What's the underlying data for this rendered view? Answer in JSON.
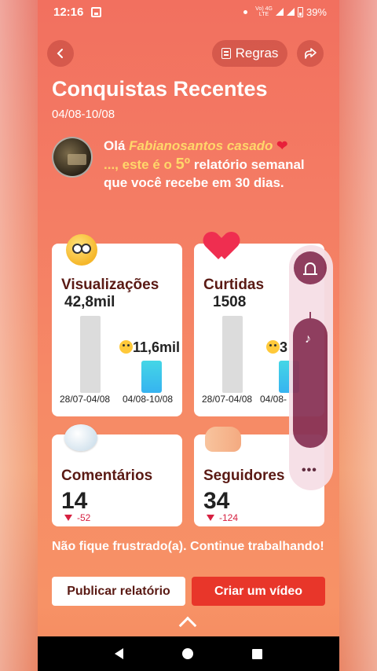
{
  "status_bar": {
    "time": "12:16",
    "network_top": "Vo) 4G",
    "network_bottom": "LTE",
    "battery": "39%"
  },
  "header": {
    "back_icon": "chevron-left-icon",
    "rules_label": "Regras",
    "share_icon": "share-arrow-icon",
    "title": "Conquistas Recentes",
    "date_range": "04/08-10/08"
  },
  "greeting": {
    "hello": "Olá",
    "name": "Fabianosantos casado",
    "line2_prefix": "..., este é o",
    "ordinal": "5º",
    "line2_suffix": "relatório semanal que você recebe em 30 dias."
  },
  "cards": {
    "views": {
      "label": "Visualizações",
      "previous_value": "42,8mil",
      "current_value": "11,6mil",
      "previous_period": "28/07-04/08",
      "current_period": "04/08-10/08",
      "previous_fraction": 1.0,
      "current_fraction": 0.42
    },
    "likes": {
      "label": "Curtidas",
      "previous_value": "1508",
      "current_value": "3",
      "previous_period": "28/07-04/08",
      "current_period": "04/08-",
      "previous_fraction": 1.0,
      "current_fraction": 0.42
    },
    "comments": {
      "label": "Comentários",
      "value": "14",
      "delta": "-52"
    },
    "followers": {
      "label": "Seguidores",
      "value": "34",
      "delta": "-124"
    }
  },
  "side_panel": {
    "bell_icon": "bell-icon",
    "music_icon": "music-note-icon",
    "more_label": "•••"
  },
  "footer": {
    "encourage": "Não fique frustrado(a). Continue trabalhando!",
    "publish_button": "Publicar relatório",
    "create_video_button": "Criar um vídeo"
  },
  "colors": {
    "accent_red": "#e8362a",
    "card_label": "#5a1a14",
    "highlight_yellow": "#ffd76a",
    "delta_red": "#d62040"
  }
}
